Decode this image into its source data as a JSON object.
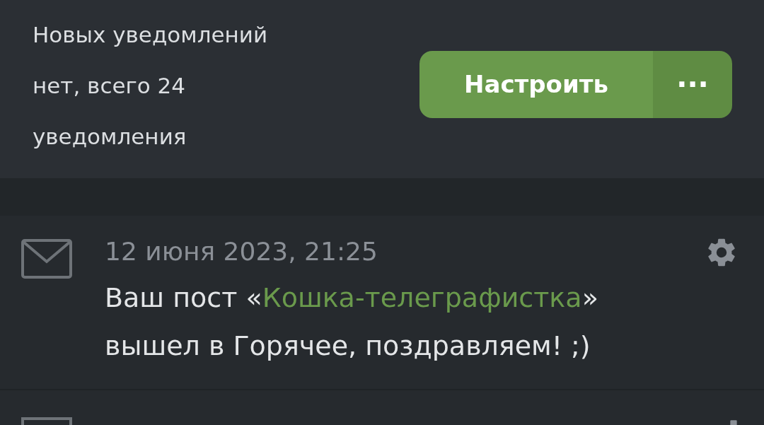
{
  "header": {
    "summary": "Новых уведомлений нет, всего 24 уведомления",
    "button": "Настроить",
    "more": "···"
  },
  "notifications": [
    {
      "date": "12 июня 2023, 21:25",
      "before": "Ваш пост «",
      "link": "Кошка-телеграфистка",
      "after": "» вышел в Горячее, поздравляем! ;)"
    }
  ]
}
